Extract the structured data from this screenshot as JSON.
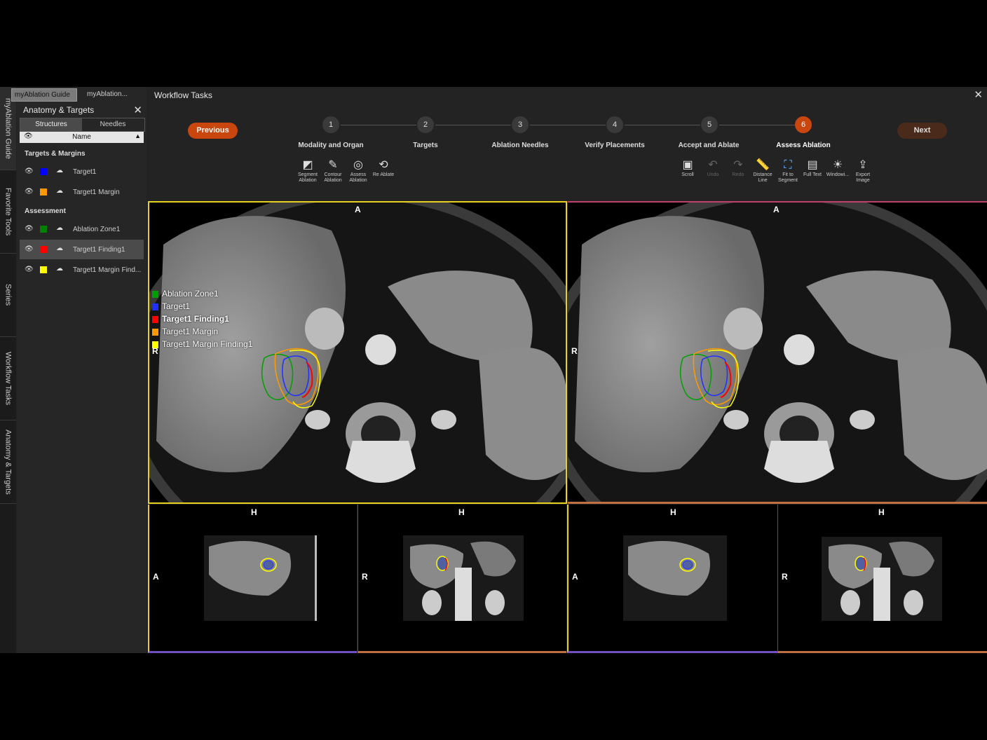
{
  "vertical_tabs": [
    "myAblation Guide",
    "Favorite Tools",
    "Series",
    "Workflow Tasks",
    "Anatomy & Targets"
  ],
  "top_tabs": [
    "myAblation Guide",
    "myAblation..."
  ],
  "left_panel": {
    "title": "Anatomy & Targets",
    "segments": [
      "Structures",
      "Needles"
    ],
    "column_header": "Name",
    "sections": [
      {
        "title": "Targets & Margins",
        "items": [
          {
            "label": "Target1",
            "color": "#0000ff"
          },
          {
            "label": "Target1 Margin",
            "color": "#ff9900"
          }
        ]
      },
      {
        "title": "Assessment",
        "items": [
          {
            "label": "Ablation Zone1",
            "color": "#008000"
          },
          {
            "label": "Target1 Finding1",
            "color": "#ff0000"
          },
          {
            "label": "Target1 Margin Find...",
            "color": "#ffff00"
          }
        ]
      }
    ]
  },
  "workflow": {
    "title": "Workflow Tasks",
    "previous_label": "Previous",
    "next_label": "Next",
    "steps": [
      {
        "num": "1",
        "label": "Modality and Organ"
      },
      {
        "num": "2",
        "label": "Targets"
      },
      {
        "num": "3",
        "label": "Ablation Needles"
      },
      {
        "num": "4",
        "label": "Verify Placements"
      },
      {
        "num": "5",
        "label": "Accept and Ablate"
      },
      {
        "num": "6",
        "label": "Assess Ablation"
      }
    ],
    "active_step": 6,
    "left_tools": [
      {
        "label": "Segment Ablation",
        "icon": "segment-ablation-icon"
      },
      {
        "label": "Contour Ablation",
        "icon": "contour-ablation-icon"
      },
      {
        "label": "Assess Ablation",
        "icon": "assess-ablation-icon"
      },
      {
        "label": "Re Ablate",
        "icon": "re-ablate-icon"
      }
    ],
    "right_tools": [
      {
        "label": "Scroll",
        "icon": "scroll-icon"
      },
      {
        "label": "Undo",
        "icon": "undo-icon"
      },
      {
        "label": "Redo",
        "icon": "redo-icon"
      },
      {
        "label": "Distance Line",
        "icon": "distance-line-icon"
      },
      {
        "label": "Fit to Segment",
        "icon": "fit-to-segment-icon"
      },
      {
        "label": "Full Text",
        "icon": "full-text-icon"
      },
      {
        "label": "Windowi...",
        "icon": "windowing-icon"
      },
      {
        "label": "Export Image",
        "icon": "export-image-icon"
      }
    ]
  },
  "viewports": {
    "left_main": {
      "top": "A",
      "left": "R"
    },
    "right_main": {
      "top": "A",
      "left": "R"
    },
    "small": [
      {
        "top": "H",
        "left": "A"
      },
      {
        "top": "H",
        "left": "R"
      },
      {
        "top": "H",
        "left": "A"
      },
      {
        "top": "H",
        "left": "R"
      }
    ]
  },
  "legend": [
    {
      "label": "Ablation Zone1",
      "color": "#00a000",
      "bold": false
    },
    {
      "label": "Target1",
      "color": "#2030ff",
      "bold": false
    },
    {
      "label": "Target1 Finding1",
      "color": "#ff0000",
      "bold": true
    },
    {
      "label": "Target1 Margin",
      "color": "#ff9900",
      "bold": false
    },
    {
      "label": "Target1 Margin Finding1",
      "color": "#ffff00",
      "bold": false
    }
  ],
  "colors": {
    "accent": "#c9470e",
    "selection_yellow": "#e8d020",
    "viewport_border_pink": "#c04070",
    "viewport_border_purple": "#7050c0",
    "viewport_border_orange": "#c07040"
  }
}
